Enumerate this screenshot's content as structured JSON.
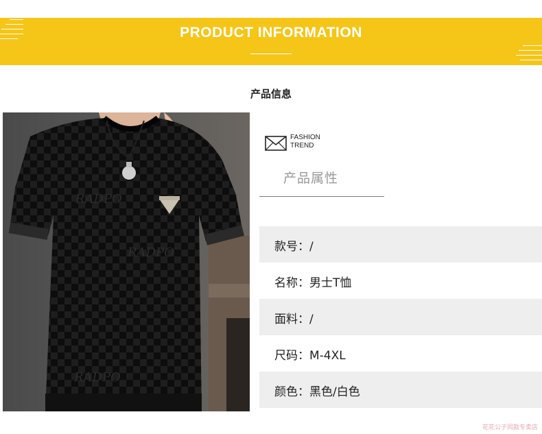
{
  "banner": {
    "title": "PRODUCT INFORMATION",
    "color": "#f5c518"
  },
  "subtitle": "产品信息",
  "attributes_header": {
    "icon": "envelope-icon",
    "fashion_line1": "FASHION",
    "fashion_line2": "TREND",
    "title": "产品属性"
  },
  "attributes": [
    {
      "text": "款号：/"
    },
    {
      "text": "名称：男士T恤"
    },
    {
      "text": "面料：/"
    },
    {
      "text": "尺码：M-4XL"
    },
    {
      "text": "颜色：黑色/白色"
    }
  ],
  "product_image": {
    "description_icon": "tshirt-photo",
    "print_text": "RADPO"
  },
  "watermark": "花花公子同款专卖店"
}
